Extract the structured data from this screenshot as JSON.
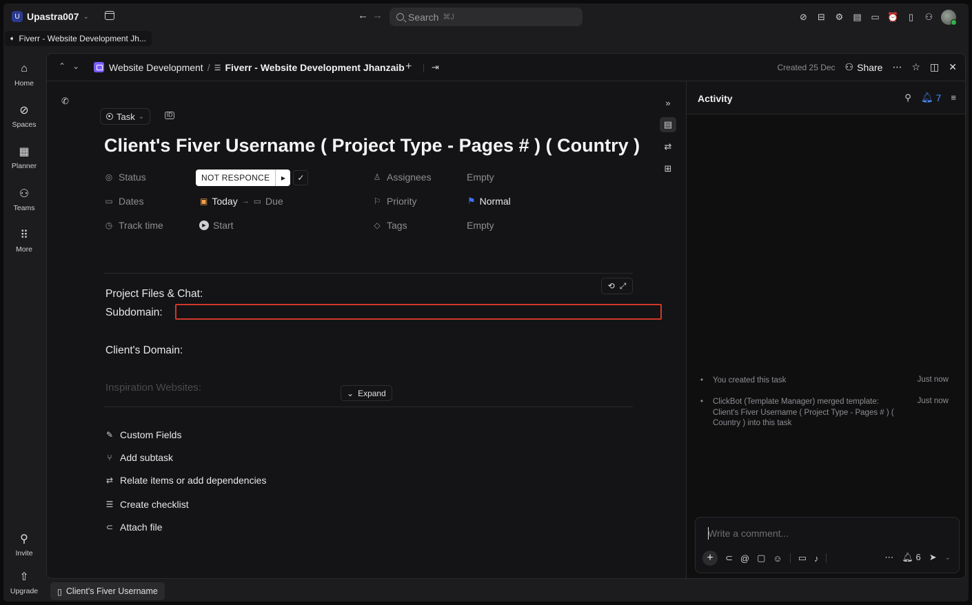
{
  "topbar": {
    "workspace_initial": "U",
    "workspace_name": "Upastra007",
    "search_placeholder": "Search",
    "search_shortcut": "⌘J"
  },
  "bookmark": {
    "label": "Fiverr - Website Development Jh..."
  },
  "rail": {
    "home": "Home",
    "spaces": "Spaces",
    "planner": "Planner",
    "teams": "Teams",
    "more": "More",
    "invite": "Invite",
    "upgrade": "Upgrade"
  },
  "breadcrumb": {
    "space": "Website Development",
    "separator": "/",
    "list": "Fiverr - Website Development Jhanzaib",
    "created": "Created 25 Dec",
    "share": "Share"
  },
  "task": {
    "type": "Task",
    "title": "Client's Fiver Username ( Project Type - Pages # ) ( Country )",
    "fields": {
      "status_label": "Status",
      "status_value": "NOT RESPONCE",
      "dates_label": "Dates",
      "start_date": "Today",
      "due_date": "Due",
      "track_time_label": "Track time",
      "track_time_value": "Start",
      "assignees_label": "Assignees",
      "assignees_value": "Empty",
      "priority_label": "Priority",
      "priority_value": "Normal",
      "tags_label": "Tags",
      "tags_value": "Empty"
    },
    "description": {
      "line1": "Project Files & Chat:",
      "line2": "Subdomain:",
      "line3": "Client's Domain:",
      "line4": "Inspiration Websites:",
      "expand": "Expand"
    },
    "actions": {
      "custom_fields": "Custom Fields",
      "add_subtask": "Add subtask",
      "relate": "Relate items or add dependencies",
      "checklist": "Create checklist",
      "attach": "Attach file"
    }
  },
  "activity": {
    "title": "Activity",
    "notification_count": "7",
    "entries": [
      {
        "text": "You created this task",
        "time": "Just now"
      },
      {
        "text": "ClickBot (Template Manager) merged template: Client's Fiver Username ( Project Type - Pages # ) ( Country ) into this task",
        "time": "Just now"
      }
    ],
    "comment_placeholder": "Write a comment...",
    "watchers_count": "6"
  },
  "bottom_tab": {
    "label": "Client's Fiver Username"
  },
  "colors": {
    "accent_blue": "#4a8cff",
    "status_bg": "#ffffff",
    "subdomain_outline": "#d2372a",
    "date_orange": "#f2a14a",
    "priority_flag": "#3d6fff",
    "space_icon": "#7b5cff"
  }
}
